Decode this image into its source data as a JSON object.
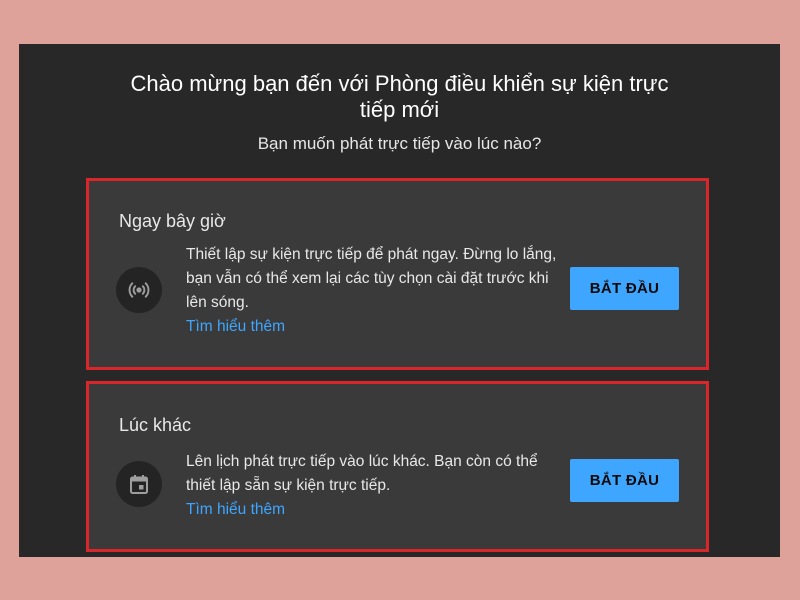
{
  "dialog": {
    "title_line1": "Chào mừng bạn đến với Phòng điều khiển sự kiện trực",
    "title_line2": "tiếp mới",
    "subtitle": "Bạn muốn phát trực tiếp vào lúc nào?"
  },
  "options": [
    {
      "title": "Ngay bây giờ",
      "icon": "live-broadcast-icon",
      "description": "Thiết lập sự kiện trực tiếp để phát ngay. Đừng lo lắng, bạn vẫn có thể xem lại các tùy chọn cài đặt trước khi lên sóng.",
      "learn_more": "Tìm hiểu thêm",
      "button": "BẮT ĐẦU"
    },
    {
      "title": "Lúc khác",
      "icon": "calendar-icon",
      "description": "Lên lịch phát trực tiếp vào lúc khác. Bạn còn có thể thiết lập sẵn sự kiện trực tiếp.",
      "learn_more": "Tìm hiểu thêm",
      "button": "BẮT ĐẦU"
    }
  ],
  "colors": {
    "background": "#dfa29b",
    "dialog": "#282828",
    "card": "#3a3a3a",
    "highlight_border": "#d8262b",
    "accent": "#3ea6ff"
  }
}
